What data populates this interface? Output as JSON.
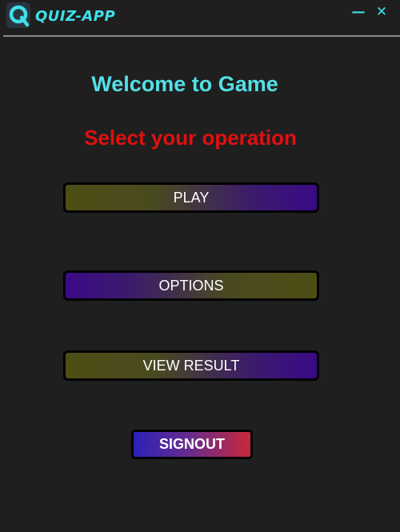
{
  "window": {
    "app_title": "QUIZ-APP",
    "minimize_label": "—",
    "close_label": "✕",
    "logo_icon": "quiz-logo-icon",
    "accent_color": "#3fe0ea"
  },
  "main": {
    "welcome_text": "Welcome to Game",
    "prompt_text": "Select your operation",
    "buttons": {
      "play": "PLAY",
      "options": "OPTIONS",
      "view_result": "VIEW RESULT",
      "signout": "SIGNOUT"
    }
  },
  "colors": {
    "background": "#1f1f1f",
    "welcome": "#52e0e6",
    "prompt": "#e01010"
  }
}
